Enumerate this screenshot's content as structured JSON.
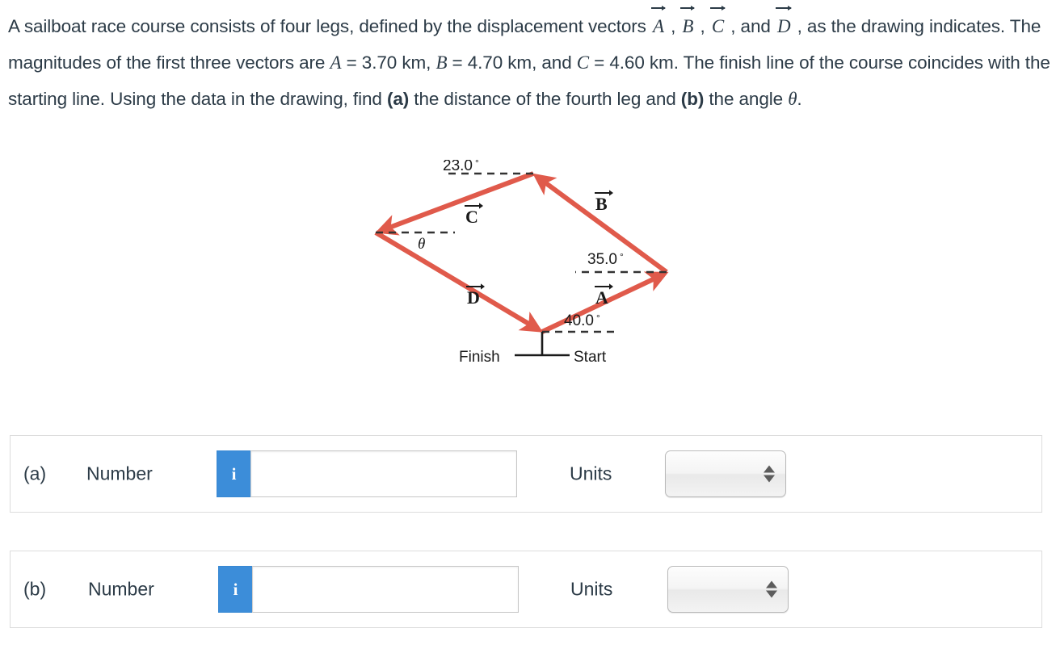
{
  "question": {
    "line1_a": "A sailboat race course consists of four legs, defined by the displacement vectors ",
    "vec_A": "A",
    "vec_B": "B",
    "vec_C": "C",
    "vec_D": "D",
    "line2_a": ", as the drawing indicates. The magnitudes of the first three vectors are ",
    "var_A": "A",
    "eq_A": " = 3.70 km, ",
    "var_B": "B",
    "eq_B": " = 4.70 km, and ",
    "var_C": "C",
    "eq_C": " = 4.60 km. The finish line of the course coincides with the starting line.",
    "line4_a": "Using the data in the drawing, find ",
    "bold_a": "(a)",
    "line4_b": " the distance of the fourth leg and ",
    "bold_b": "(b)",
    "line4_c": " the angle ",
    "theta_symbol": "θ",
    "period": "."
  },
  "figure": {
    "type": "vector-diagram",
    "stroke_color": "#e05a4b",
    "label_color": "#1a1a1a",
    "angles": [
      {
        "id": "angle-23",
        "text": "23.0°",
        "at_vertex": "top"
      },
      {
        "id": "angle-theta",
        "text": "θ",
        "at_vertex": "left"
      },
      {
        "id": "angle-35",
        "text": "35.0°",
        "at_vertex": "right"
      },
      {
        "id": "angle-40",
        "text": "40.0°",
        "at_vertex": "start"
      }
    ],
    "vector_labels": [
      {
        "id": "label-A",
        "text": "A"
      },
      {
        "id": "label-B",
        "text": "B"
      },
      {
        "id": "label-C",
        "text": "C"
      },
      {
        "id": "label-D",
        "text": "D"
      }
    ],
    "markers": {
      "finish": "Finish",
      "start": "Start"
    }
  },
  "answers": [
    {
      "id": "a",
      "row_label": "(a)",
      "number_label": "Number",
      "info_icon": "i",
      "value": "",
      "units_label": "Units",
      "unit_value": ""
    },
    {
      "id": "b",
      "row_label": "(b)",
      "number_label": "Number",
      "info_icon": "i",
      "value": "",
      "units_label": "Units",
      "unit_value": ""
    }
  ],
  "colors": {
    "accent_blue": "#3c8dd9",
    "vector_red": "#e05a4b",
    "text": "#2c3b47",
    "panel_border": "#dcdcdc"
  }
}
